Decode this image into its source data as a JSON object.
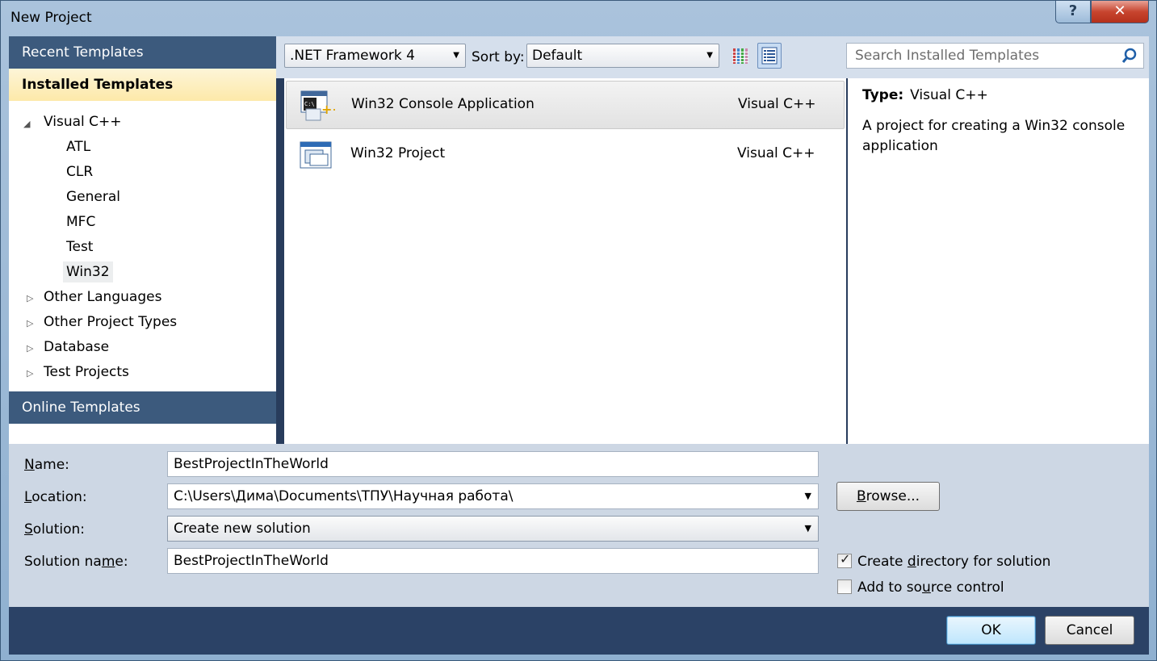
{
  "window": {
    "title": "New Project",
    "help_label": "?",
    "close_label": "✕"
  },
  "sidebar": {
    "recent": "Recent Templates",
    "installed": "Installed Templates",
    "online": "Online Templates",
    "tree": {
      "visual_cpp": "Visual C++",
      "children": [
        "ATL",
        "CLR",
        "General",
        "MFC",
        "Test",
        "Win32"
      ],
      "other_languages": "Other Languages",
      "other_project_types": "Other Project Types",
      "database": "Database",
      "test_projects": "Test Projects"
    }
  },
  "toolbar": {
    "framework": ".NET Framework 4",
    "sort_label": "Sort by:",
    "sort_value": "Default",
    "search_placeholder": "Search Installed Templates"
  },
  "templates": [
    {
      "name": "Win32 Console Application",
      "lang": "Visual C++",
      "selected": true
    },
    {
      "name": "Win32 Project",
      "lang": "Visual C++",
      "selected": false
    }
  ],
  "details": {
    "type_label": "Type:",
    "type_value": "Visual C++",
    "description": "A project for creating a Win32 console application"
  },
  "form": {
    "name_label_pre": "",
    "name_label_u": "N",
    "name_label_post": "ame:",
    "name_value": "BestProjectInTheWorld",
    "location_label_pre": "",
    "location_label_u": "L",
    "location_label_post": "ocation:",
    "location_value": "C:\\Users\\Дима\\Documents\\ТПУ\\Научная работа\\",
    "solution_label_pre": "",
    "solution_label_u": "S",
    "solution_label_post": "olution:",
    "solution_value": "Create new solution",
    "solution_name_label_pre": "Solution na",
    "solution_name_label_u": "m",
    "solution_name_label_post": "e:",
    "solution_name_value": "BestProjectInTheWorld",
    "browse_pre": "",
    "browse_u": "B",
    "browse_post": "rowse...",
    "create_dir_pre": "Create ",
    "create_dir_u": "d",
    "create_dir_post": "irectory for solution",
    "create_dir_checked": true,
    "source_pre": "Add to so",
    "source_u": "u",
    "source_post": "rce control",
    "source_checked": false
  },
  "buttons": {
    "ok": "OK",
    "cancel": "Cancel"
  },
  "colors": {
    "accent": "#3c5a7d",
    "installed_bg": "#fde9a9",
    "footer": "#2b4266"
  }
}
